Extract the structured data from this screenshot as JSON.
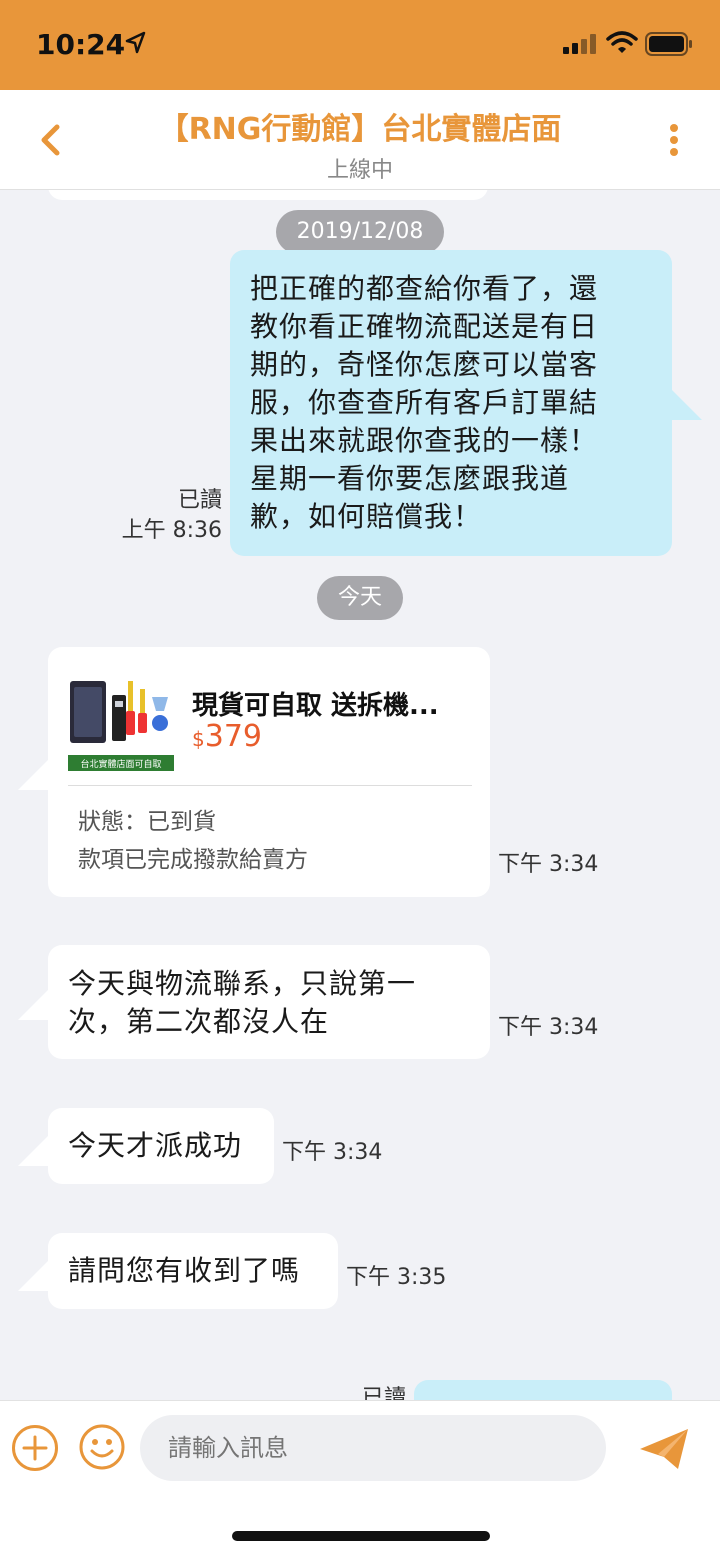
{
  "status_bar": {
    "time": "10:24"
  },
  "header": {
    "title": "【RNG行動館】台北實體店面",
    "subtitle": "上線中"
  },
  "messages": {
    "date1": "2019/12/08",
    "out1": {
      "lines": [
        "把正確的都查給你看了，還",
        "教你看正確物流配送是有日",
        "期的，奇怪你怎麼可以當客",
        "服，你查查所有客戶訂單結",
        "果出來就跟你查我的一樣！",
        "星期一看你要怎麼跟我道",
        "歉，如何賠償我！"
      ],
      "read": "已讀",
      "time": "上午 8:36"
    },
    "date2": "今天",
    "product": {
      "name": "現貨可自取 送拆機...",
      "currency": "$",
      "price": "379",
      "thumb_caption": "台北實體店面可自取",
      "status_label": "狀態：已到貨",
      "payment": "款項已完成撥款給賣方",
      "time": "下午 3:34"
    },
    "in1": {
      "lines": [
        "今天與物流聯系，只說第一",
        "次，第二次都沒人在"
      ],
      "time": "下午 3:34"
    },
    "in2": {
      "text": "今天才派成功",
      "time": "下午 3:34"
    },
    "in3": {
      "text": "請問您有收到了嗎",
      "time": "下午 3:35"
    },
    "out2": {
      "read": "已讀"
    }
  },
  "input": {
    "placeholder": "請輸入訊息"
  },
  "colors": {
    "brand": "#e8963a",
    "outgoing": "#c9eef9",
    "price": "#e85d2c"
  }
}
